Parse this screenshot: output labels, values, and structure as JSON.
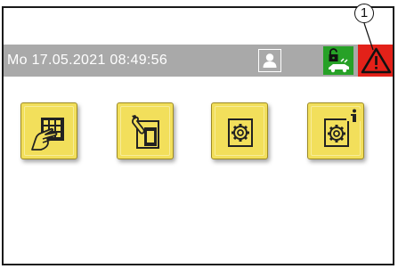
{
  "status_bar": {
    "datetime": "Mo 17.05.2021  08:49:56"
  },
  "callout": {
    "number": "1"
  },
  "icons": {
    "user": "user-icon",
    "lock": "lock-vehicle-icon",
    "alarm": "warning-triangle-icon",
    "tile1": "hand-keypad-icon",
    "tile2": "service-wrench-icon",
    "tile3": "settings-gear-icon",
    "tile4": "settings-info-icon"
  },
  "colors": {
    "bar": "#a9a9a9",
    "tile": "#f2df5b",
    "lock": "#27a127",
    "alarm": "#e32119"
  }
}
